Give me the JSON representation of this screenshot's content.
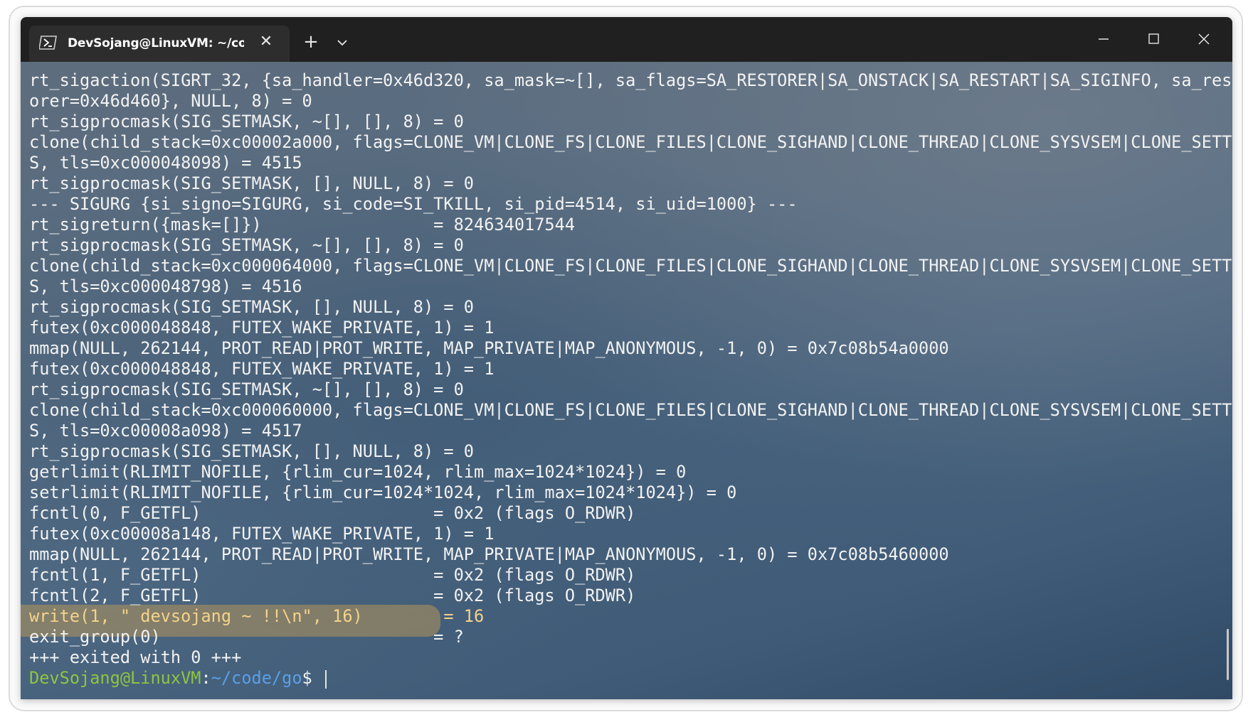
{
  "window": {
    "tab_title": "DevSojang@LinuxVM: ~/code",
    "tab_icon": "powershell-icon",
    "new_tab_symbol": "+",
    "close_tab_symbol": "✕"
  },
  "terminal": {
    "lines": [
      "rt_sigaction(SIGRT_32, {sa_handler=0x46d320, sa_mask=~[], sa_flags=SA_RESTORER|SA_ONSTACK|SA_RESTART|SA_SIGINFO, sa_rest",
      "orer=0x46d460}, NULL, 8) = 0",
      "rt_sigprocmask(SIG_SETMASK, ~[], [], 8) = 0",
      "clone(child_stack=0xc00002a000, flags=CLONE_VM|CLONE_FS|CLONE_FILES|CLONE_SIGHAND|CLONE_THREAD|CLONE_SYSVSEM|CLONE_SETTL",
      "S, tls=0xc000048098) = 4515",
      "rt_sigprocmask(SIG_SETMASK, [], NULL, 8) = 0",
      "--- SIGURG {si_signo=SIGURG, si_code=SI_TKILL, si_pid=4514, si_uid=1000} ---",
      "rt_sigreturn({mask=[]})                 = 824634017544",
      "rt_sigprocmask(SIG_SETMASK, ~[], [], 8) = 0",
      "clone(child_stack=0xc000064000, flags=CLONE_VM|CLONE_FS|CLONE_FILES|CLONE_SIGHAND|CLONE_THREAD|CLONE_SYSVSEM|CLONE_SETTL",
      "S, tls=0xc000048798) = 4516",
      "rt_sigprocmask(SIG_SETMASK, [], NULL, 8) = 0",
      "futex(0xc000048848, FUTEX_WAKE_PRIVATE, 1) = 1",
      "mmap(NULL, 262144, PROT_READ|PROT_WRITE, MAP_PRIVATE|MAP_ANONYMOUS, -1, 0) = 0x7c08b54a0000",
      "futex(0xc000048848, FUTEX_WAKE_PRIVATE, 1) = 1",
      "rt_sigprocmask(SIG_SETMASK, ~[], [], 8) = 0",
      "clone(child_stack=0xc000060000, flags=CLONE_VM|CLONE_FS|CLONE_FILES|CLONE_SIGHAND|CLONE_THREAD|CLONE_SYSVSEM|CLONE_SETTL",
      "S, tls=0xc00008a098) = 4517",
      "rt_sigprocmask(SIG_SETMASK, [], NULL, 8) = 0",
      "getrlimit(RLIMIT_NOFILE, {rlim_cur=1024, rlim_max=1024*1024}) = 0",
      "setrlimit(RLIMIT_NOFILE, {rlim_cur=1024*1024, rlim_max=1024*1024}) = 0",
      "fcntl(0, F_GETFL)                       = 0x2 (flags O_RDWR)",
      "futex(0xc00008a148, FUTEX_WAKE_PRIVATE, 1) = 1",
      "mmap(NULL, 262144, PROT_READ|PROT_WRITE, MAP_PRIVATE|MAP_ANONYMOUS, -1, 0) = 0x7c08b5460000",
      "fcntl(1, F_GETFL)                       = 0x2 (flags O_RDWR)",
      "fcntl(2, F_GETFL)                       = 0x2 (flags O_RDWR)"
    ],
    "highlighted_line": "write(1, \" devsojang ~ !!\\n\", 16)        = 16",
    "after_lines": [
      "exit_group(0)                           = ?",
      "+++ exited with 0 +++"
    ],
    "prompt": {
      "user_host": "DevSojang@LinuxVM",
      "separator": ":",
      "path": "~/code/go",
      "symbol": "$ "
    }
  }
}
